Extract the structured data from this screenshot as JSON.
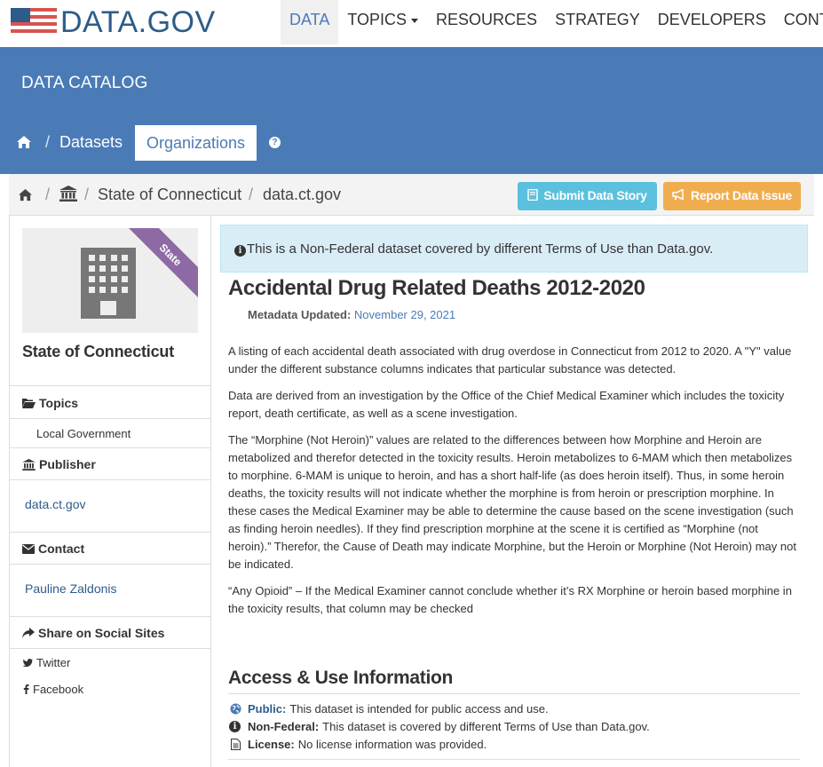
{
  "brand": {
    "logo_text": "DATA.GOV"
  },
  "topnav": {
    "items": [
      {
        "label": "DATA",
        "active": true
      },
      {
        "label": "TOPICS",
        "has_caret": true
      },
      {
        "label": "RESOURCES"
      },
      {
        "label": "STRATEGY"
      },
      {
        "label": "DEVELOPERS"
      },
      {
        "label": "CONTACT"
      }
    ]
  },
  "catalog": {
    "title": "DATA CATALOG",
    "sep": "/",
    "datasets_label": "Datasets",
    "organizations_tab": "Organizations",
    "help_glyph": "?"
  },
  "breadcrumb": {
    "sep": "/",
    "items": [
      "State of Connecticut",
      "data.ct.gov"
    ]
  },
  "actions": {
    "submit_story": "Submit Data Story",
    "report_issue": "Report Data Issue"
  },
  "sidebar": {
    "org_badge": "State",
    "org_name": "State of Connecticut",
    "topics_heading": "Topics",
    "topic_item": "Local Government",
    "publisher_heading": "Publisher",
    "publisher_link": "data.ct.gov",
    "contact_heading": "Contact",
    "contact_link": "Pauline Zaldonis",
    "share_heading": "Share on Social Sites",
    "twitter_label": "Twitter",
    "facebook_label": "Facebook"
  },
  "notice": {
    "info_glyph": "i",
    "text": "This is a Non-Federal dataset covered by different Terms of Use than Data.gov."
  },
  "dataset": {
    "title": "Accidental Drug Related Deaths 2012-2020",
    "metadata_label": "Metadata Updated:",
    "metadata_date": "November 29, 2021",
    "paragraphs": [
      "A listing of each accidental death associated with drug overdose in Connecticut from 2012 to 2020. A \"Y\" value under the different substance columns indicates that particular substance was detected.",
      "Data are derived from an investigation by the Office of the Chief Medical Examiner which includes the toxicity report, death certificate, as well as a scene investigation.",
      "The “Morphine (Not Heroin)” values are related to the differences between how Morphine and Heroin are metabolized and therefor detected in the toxicity results. Heroin metabolizes to 6-MAM which then metabolizes to morphine. 6-MAM is unique to heroin, and has a short half-life (as does heroin itself). Thus, in some heroin deaths, the toxicity results will not indicate whether the morphine is from heroin or prescription morphine. In these cases the Medical Examiner may be able to determine the cause based on the scene investigation (such as finding heroin needles). If they find prescription morphine at the scene it is certified as “Morphine (not heroin).” Therefor, the Cause of Death may indicate Morphine, but the Heroin or Morphine (Not Heroin) may not be indicated.",
      "“Any Opioid” – If the Medical Examiner cannot conclude whether it’s RX Morphine or heroin based morphine in the toxicity results, that column may be checked"
    ]
  },
  "access": {
    "title": "Access & Use Information",
    "public_label": "Public:",
    "public_text": "This dataset is intended for public access and use.",
    "nonfederal_label": "Non-Federal:",
    "nonfederal_text": "This dataset is covered by different Terms of Use than Data.gov.",
    "license_label": "License:",
    "license_text": "No license information was provided.",
    "nonfederal_glyph": "i"
  },
  "colors": {
    "primary_blue": "#4a7bb7",
    "info_button": "#5bc0de",
    "warning_button": "#f0ad4e",
    "state_ribbon": "#8e6aa5",
    "alert_bg": "#d9edf7"
  }
}
